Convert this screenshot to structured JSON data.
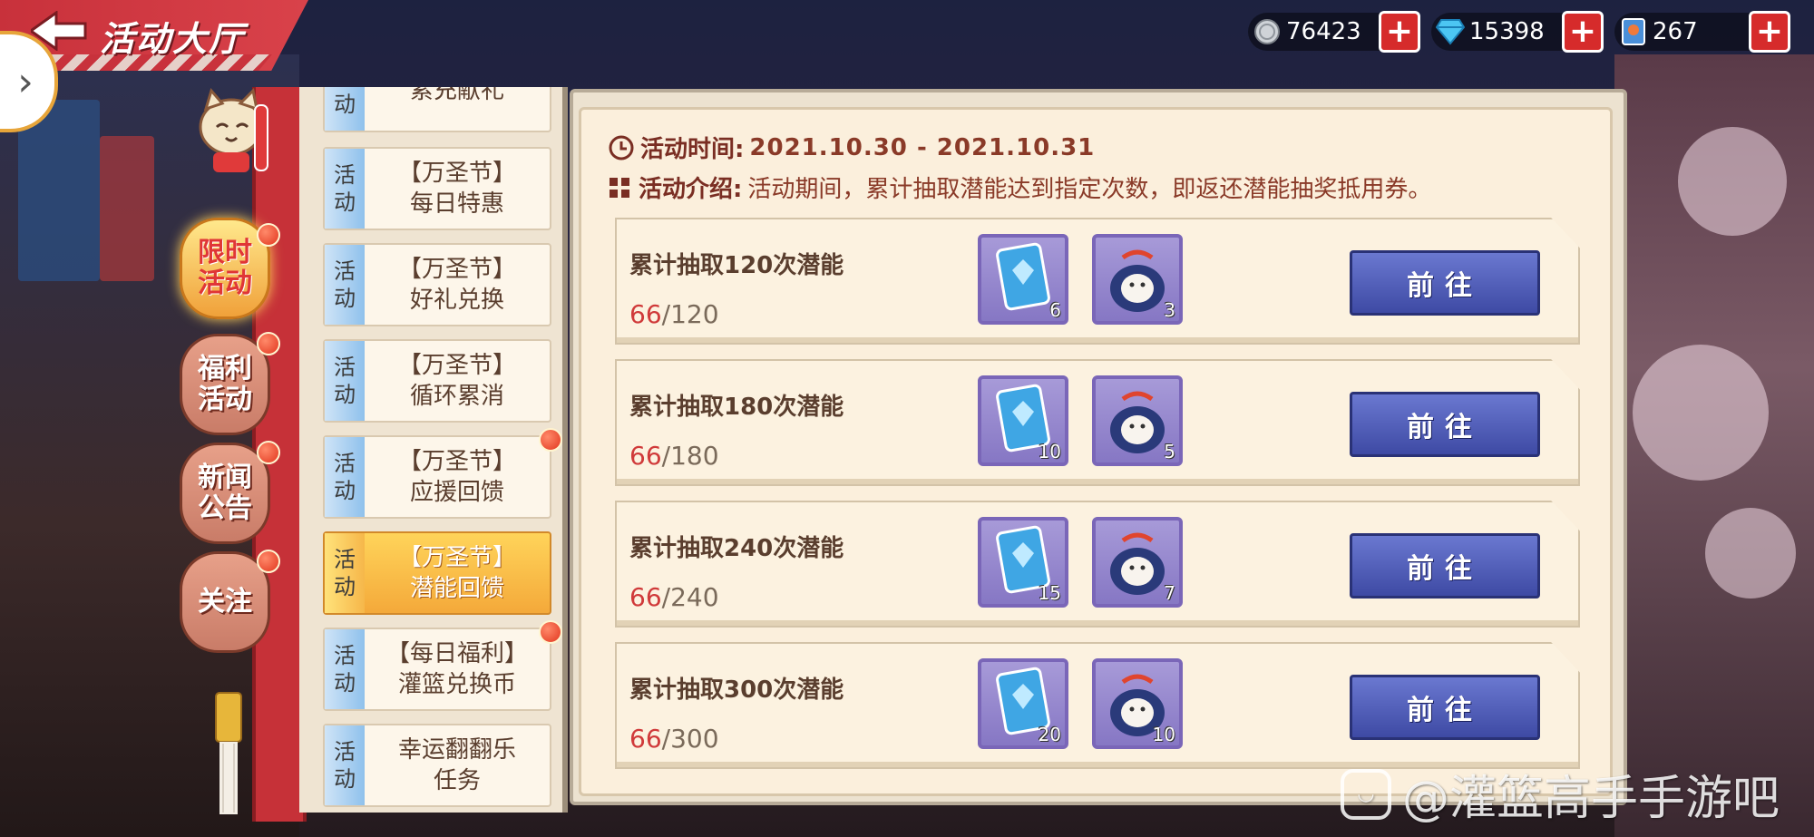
{
  "header": {
    "title": "活动大厅",
    "currencies": [
      {
        "icon": "silver-coin-icon",
        "value": "76423"
      },
      {
        "icon": "diamond-icon",
        "value": "15398"
      },
      {
        "icon": "ticket-icon",
        "value": "267"
      }
    ],
    "plus_label": "+"
  },
  "categories": [
    {
      "label": "限时活动",
      "active": true
    },
    {
      "label": "福利活动",
      "active": false
    },
    {
      "label": "新闻公告",
      "active": false
    },
    {
      "label": "关注",
      "active": false
    }
  ],
  "activity_tag": [
    "活",
    "动"
  ],
  "activities": [
    {
      "line1": "累充献礼",
      "line2": ""
    },
    {
      "line1": "【万圣节】",
      "line2": "每日特惠"
    },
    {
      "line1": "【万圣节】",
      "line2": "好礼兑换"
    },
    {
      "line1": "【万圣节】",
      "line2": "循环累消"
    },
    {
      "line1": "【万圣节】",
      "line2": "应援回馈"
    },
    {
      "line1": "【万圣节】",
      "line2": "潜能回馈"
    },
    {
      "line1": "【每日福利】",
      "line2": "灌篮兑换币"
    },
    {
      "line1": "幸运翻翻乐",
      "line2": "任务"
    }
  ],
  "event": {
    "time_label": "活动时间:",
    "time_value": "2021.10.30 - 2021.10.31",
    "intro_label": "活动介绍:",
    "intro_value": "活动期间，累计抽取潜能达到指定次数，即返还潜能抽奖抵用券。"
  },
  "tasks": [
    {
      "title": "累计抽取120次潜能",
      "current": "66",
      "target": "/120",
      "rewards": [
        {
          "icon": "potential-card-icon",
          "qty": "6"
        },
        {
          "icon": "lucky-cat-bag-icon",
          "qty": "3"
        }
      ],
      "button": "前往"
    },
    {
      "title": "累计抽取180次潜能",
      "current": "66",
      "target": "/180",
      "rewards": [
        {
          "icon": "potential-card-icon",
          "qty": "10"
        },
        {
          "icon": "lucky-cat-bag-icon",
          "qty": "5"
        }
      ],
      "button": "前往"
    },
    {
      "title": "累计抽取240次潜能",
      "current": "66",
      "target": "/240",
      "rewards": [
        {
          "icon": "potential-card-icon",
          "qty": "15"
        },
        {
          "icon": "lucky-cat-bag-icon",
          "qty": "7"
        }
      ],
      "button": "前往"
    },
    {
      "title": "累计抽取300次潜能",
      "current": "66",
      "target": "/300",
      "rewards": [
        {
          "icon": "potential-card-icon",
          "qty": "20"
        },
        {
          "icon": "lucky-cat-bag-icon",
          "qty": "10"
        }
      ],
      "button": "前往"
    }
  ],
  "watermark": {
    "text": "@灌篮高手手游吧"
  },
  "colors": {
    "accent_red": "#c63138",
    "button_blue": "#3e4aa4",
    "progress_red": "#d03a3a"
  }
}
